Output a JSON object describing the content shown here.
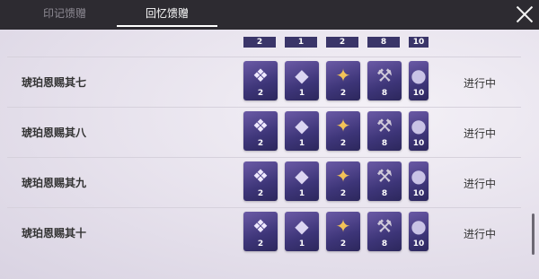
{
  "tabs": [
    {
      "label": "印记馈赠"
    },
    {
      "label": "回忆馈赠"
    }
  ],
  "partial_row_counts": [
    "2",
    "1",
    "2",
    "8",
    "10"
  ],
  "rows": [
    {
      "name": "琥珀恩赐其七",
      "status": "进行中",
      "items": [
        {
          "icon": "crystal-box-icon",
          "count": "2"
        },
        {
          "icon": "crystal-gem-icon",
          "count": "1"
        },
        {
          "icon": "gold-sparkle-icon",
          "count": "2"
        },
        {
          "icon": "pickaxe-icon",
          "count": "8"
        },
        {
          "icon": "orb-icon",
          "count": "10"
        }
      ]
    },
    {
      "name": "琥珀恩赐其八",
      "status": "进行中",
      "items": [
        {
          "icon": "crystal-box-icon",
          "count": "2"
        },
        {
          "icon": "crystal-gem-icon",
          "count": "1"
        },
        {
          "icon": "gold-sparkle-icon",
          "count": "2"
        },
        {
          "icon": "pickaxe-icon",
          "count": "8"
        },
        {
          "icon": "orb-icon",
          "count": "10"
        }
      ]
    },
    {
      "name": "琥珀恩赐其九",
      "status": "进行中",
      "items": [
        {
          "icon": "crystal-box-icon",
          "count": "2"
        },
        {
          "icon": "crystal-gem-icon",
          "count": "1"
        },
        {
          "icon": "gold-sparkle-icon",
          "count": "2"
        },
        {
          "icon": "pickaxe-icon",
          "count": "8"
        },
        {
          "icon": "orb-icon",
          "count": "10"
        }
      ]
    },
    {
      "name": "琥珀恩赐其十",
      "status": "进行中",
      "items": [
        {
          "icon": "crystal-box-icon",
          "count": "2"
        },
        {
          "icon": "crystal-gem-icon",
          "count": "1"
        },
        {
          "icon": "gold-sparkle-icon",
          "count": "2"
        },
        {
          "icon": "pickaxe-icon",
          "count": "8"
        },
        {
          "icon": "orb-icon",
          "count": "10"
        }
      ]
    }
  ]
}
